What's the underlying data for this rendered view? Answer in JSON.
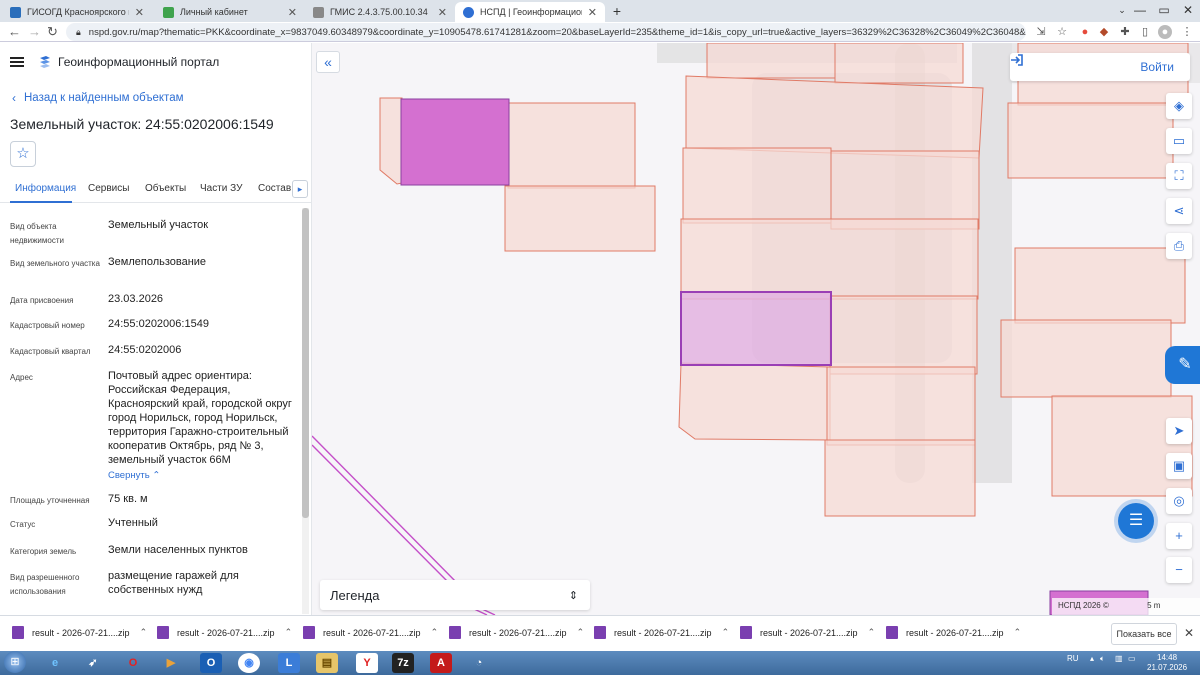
{
  "browser": {
    "tabs": [
      {
        "title": "ГИСОГД Красноярского края",
        "color": "#2a6ebb"
      },
      {
        "title": "Личный кабинет",
        "color": "#3fa34d"
      },
      {
        "title": "ГМИС 2.4.3.75.00.10.34",
        "color": "#888888"
      },
      {
        "title": "НСПД | Геоинформационный п",
        "color": "#2f6fd3"
      }
    ],
    "url": "nspd.gov.ru/map?thematic=PKK&coordinate_x=9837049.60348979&coordinate_y=10905478.61741281&zoom=20&baseLayerId=235&theme_id=1&is_copy_url=true&active_layers=36329%2C36328%2C36049%2C36048&selectedCard=17186..."
  },
  "app": {
    "brand": "Геоинформационный портал",
    "back_label": "Назад к найденным объектам",
    "title": "Земельный участок: 24:55:0202006:1549",
    "tabs": [
      "Информация",
      "Сервисы",
      "Объекты",
      "Части ЗУ",
      "Состав"
    ],
    "fields": [
      {
        "label": "Вид объекта недвижимости",
        "value": "Земельный участок"
      },
      {
        "label": "Вид земельного участка",
        "value": "Землепользование"
      },
      {
        "label": "Дата присвоения",
        "value": "23.03.2026"
      },
      {
        "label": "Кадастровый номер",
        "value": "24:55:0202006:1549"
      },
      {
        "label": "Кадастровый квартал",
        "value": "24:55:0202006"
      },
      {
        "label": "Адрес",
        "value": "Почтовый адрес ориентира: Российская Федерация, Красноярский край, городской округ город Норильск, город Норильск, территория Гаражно-строительный кооператив Октябрь, ряд № 3, земельный участок 66М"
      },
      {
        "label": "Площадь уточненная",
        "value": "75 кв. м"
      },
      {
        "label": "Статус",
        "value": "Учтенный"
      },
      {
        "label": "Категория земель",
        "value": "Земли населенных пунктов"
      },
      {
        "label": "Вид разрешенного использования",
        "value": "размещение гаражей для собственных нужд"
      }
    ],
    "collapse_label": "Свернуть"
  },
  "map": {
    "login_label": "Войти",
    "legend_label": "Легенда",
    "copyright": "НСПД 2026 ©",
    "scale": "5 m",
    "colors": {
      "parcel_fill": "#f6d9d4",
      "parcel_stroke": "#e07a66",
      "selected_fill": "#d470d0",
      "selected_stroke": "#8a3fa0"
    }
  },
  "downloads": {
    "items": [
      "result - 2026-07-21....zip",
      "result - 2026-07-21....zip",
      "result - 2026-07-21....zip",
      "result - 2026-07-21....zip",
      "result - 2026-07-21....zip",
      "result - 2026-07-21....zip",
      "result - 2026-07-21....zip"
    ],
    "show_all": "Показать все"
  },
  "taskbar": {
    "lang": "RU",
    "time": "14:48",
    "date": "21.07.2026"
  }
}
